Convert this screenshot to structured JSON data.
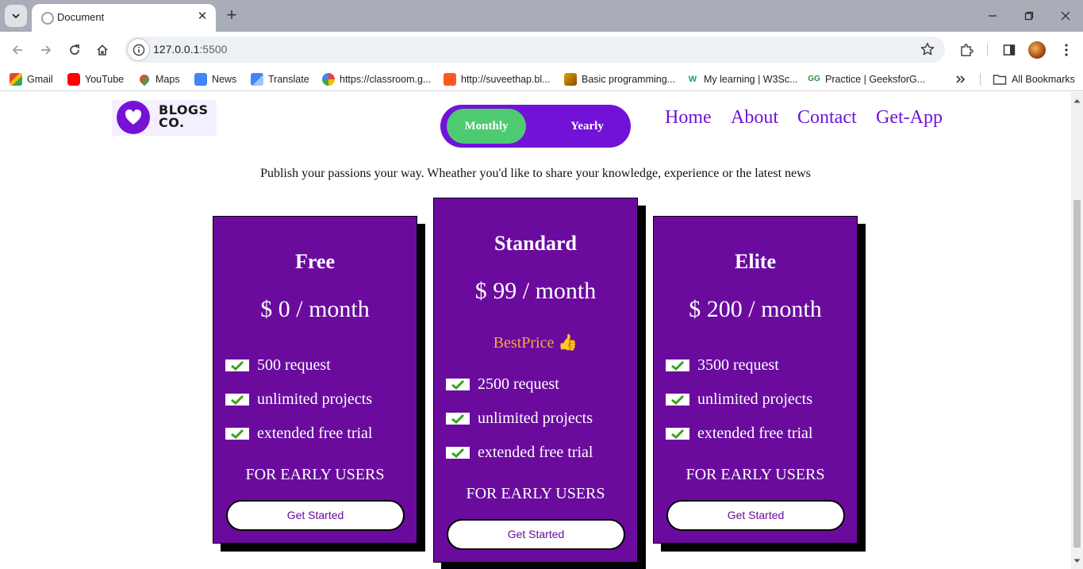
{
  "browser": {
    "tab_title": "Document",
    "url_host": "127.0.0.1",
    "url_port": ":5500",
    "bookmarks": [
      {
        "label": "Gmail",
        "icon": "gmail-icon"
      },
      {
        "label": "YouTube",
        "icon": "youtube-icon"
      },
      {
        "label": "Maps",
        "icon": "maps-icon"
      },
      {
        "label": "News",
        "icon": "news-icon"
      },
      {
        "label": "Translate",
        "icon": "translate-icon"
      },
      {
        "label": "https://classroom.g...",
        "icon": "google-icon"
      },
      {
        "label": "http://suveethap.bl...",
        "icon": "blogger-icon"
      },
      {
        "label": "Basic programming...",
        "icon": "video-icon"
      },
      {
        "label": "My learning | W3Sc...",
        "icon": "w3schools-icon"
      },
      {
        "label": "Practice | GeeksforG...",
        "icon": "geeksforgeeks-icon"
      }
    ],
    "all_bookmarks": "All Bookmarks"
  },
  "header": {
    "logo_line1": "BLOGS",
    "logo_line2": "CO.",
    "toggle_monthly": "Monthly",
    "toggle_yearly": "Yearly",
    "nav": [
      "Home",
      "About",
      "Contact",
      "Get-App"
    ]
  },
  "tagline": "Publish your passions your way. Wheather you'd like to share your knowledge, experience or the latest news",
  "plans": [
    {
      "name": "Free",
      "price": "$ 0 / month",
      "features": [
        "500 request",
        "unlimited projects",
        "extended free trial"
      ],
      "note": "FOR EARLY USERS",
      "cta": "Get Started"
    },
    {
      "name": "Standard",
      "price": "$ 99 / month",
      "badge": "BestPrice 👍",
      "features": [
        "2500 request",
        "unlimited projects",
        "extended free trial"
      ],
      "note": "FOR EARLY USERS",
      "cta": "Get Started"
    },
    {
      "name": "Elite",
      "price": "$ 200 / month",
      "features": [
        "3500 request",
        "unlimited projects",
        "extended free trial"
      ],
      "note": "FOR EARLY USERS",
      "cta": "Get Started"
    }
  ],
  "colors": {
    "card_bg": "#6a0b9e",
    "accent": "#7212d8",
    "toggle_active": "#4ecb71",
    "best_price": "#f4a93a",
    "check_mark": "#3aa31b"
  }
}
